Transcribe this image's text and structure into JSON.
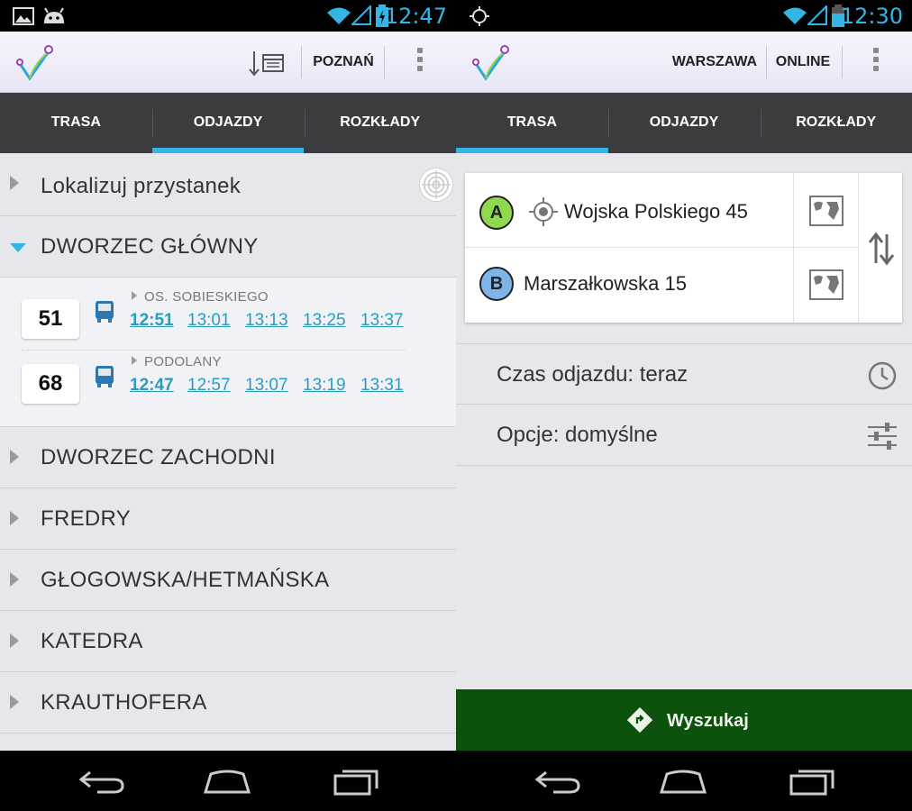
{
  "left": {
    "status": {
      "time": "12:47"
    },
    "actionbar": {
      "city": "POZNAŃ"
    },
    "tabs": [
      {
        "label": "TRASA"
      },
      {
        "label": "ODJAZDY"
      },
      {
        "label": "ROZKŁADY"
      }
    ],
    "active_tab": "ODJAZDY",
    "locate_label": "Lokalizuj przystanek",
    "expanded_stop": {
      "name": "DWORZEC GŁÓWNY",
      "departures": [
        {
          "line": "51",
          "destination": "OS. SOBIESKIEGO",
          "times": [
            "12:51",
            "13:01",
            "13:13",
            "13:25",
            "13:37"
          ]
        },
        {
          "line": "68",
          "destination": "PODOLANY",
          "times": [
            "12:47",
            "12:57",
            "13:07",
            "13:19",
            "13:31"
          ]
        }
      ]
    },
    "stops": [
      "DWORZEC ZACHODNI",
      "FREDRY",
      "GŁOGOWSKA/HETMAŃSKA",
      "KATEDRA",
      "KRAUTHOFERA"
    ]
  },
  "right": {
    "status": {
      "time": "12:30"
    },
    "actionbar": {
      "city": "WARSZAWA",
      "mode": "ONLINE"
    },
    "tabs": [
      {
        "label": "TRASA"
      },
      {
        "label": "ODJAZDY"
      },
      {
        "label": "ROZKŁADY"
      }
    ],
    "active_tab": "TRASA",
    "route": {
      "from_marker": "A",
      "from": "Wojska Polskiego 45",
      "to_marker": "B",
      "to": "Marszałkowska 15"
    },
    "departure_time": "Czas odjazdu: teraz",
    "options": "Opcje: domyślne",
    "search_label": "Wyszukaj"
  },
  "colors": {
    "accent": "#33b5e5",
    "tab_bar": "#3b3c3e",
    "search_bar": "#0c520c",
    "link": "#2b9bc0",
    "pin_a": "#8fd94f",
    "pin_b": "#7fb5e6"
  },
  "icons": {
    "status_left_screen": [
      "gallery-icon",
      "android-icon",
      "wifi-icon",
      "signal-icon",
      "battery-charging-icon"
    ],
    "status_right_screen": [
      "gps-icon",
      "wifi-icon",
      "signal-icon",
      "battery-icon"
    ],
    "actionbar": [
      "app-logo-icon",
      "sort-calendar-icon",
      "overflow-menu-icon"
    ],
    "nav": [
      "back-icon",
      "home-icon",
      "recent-apps-icon"
    ]
  }
}
